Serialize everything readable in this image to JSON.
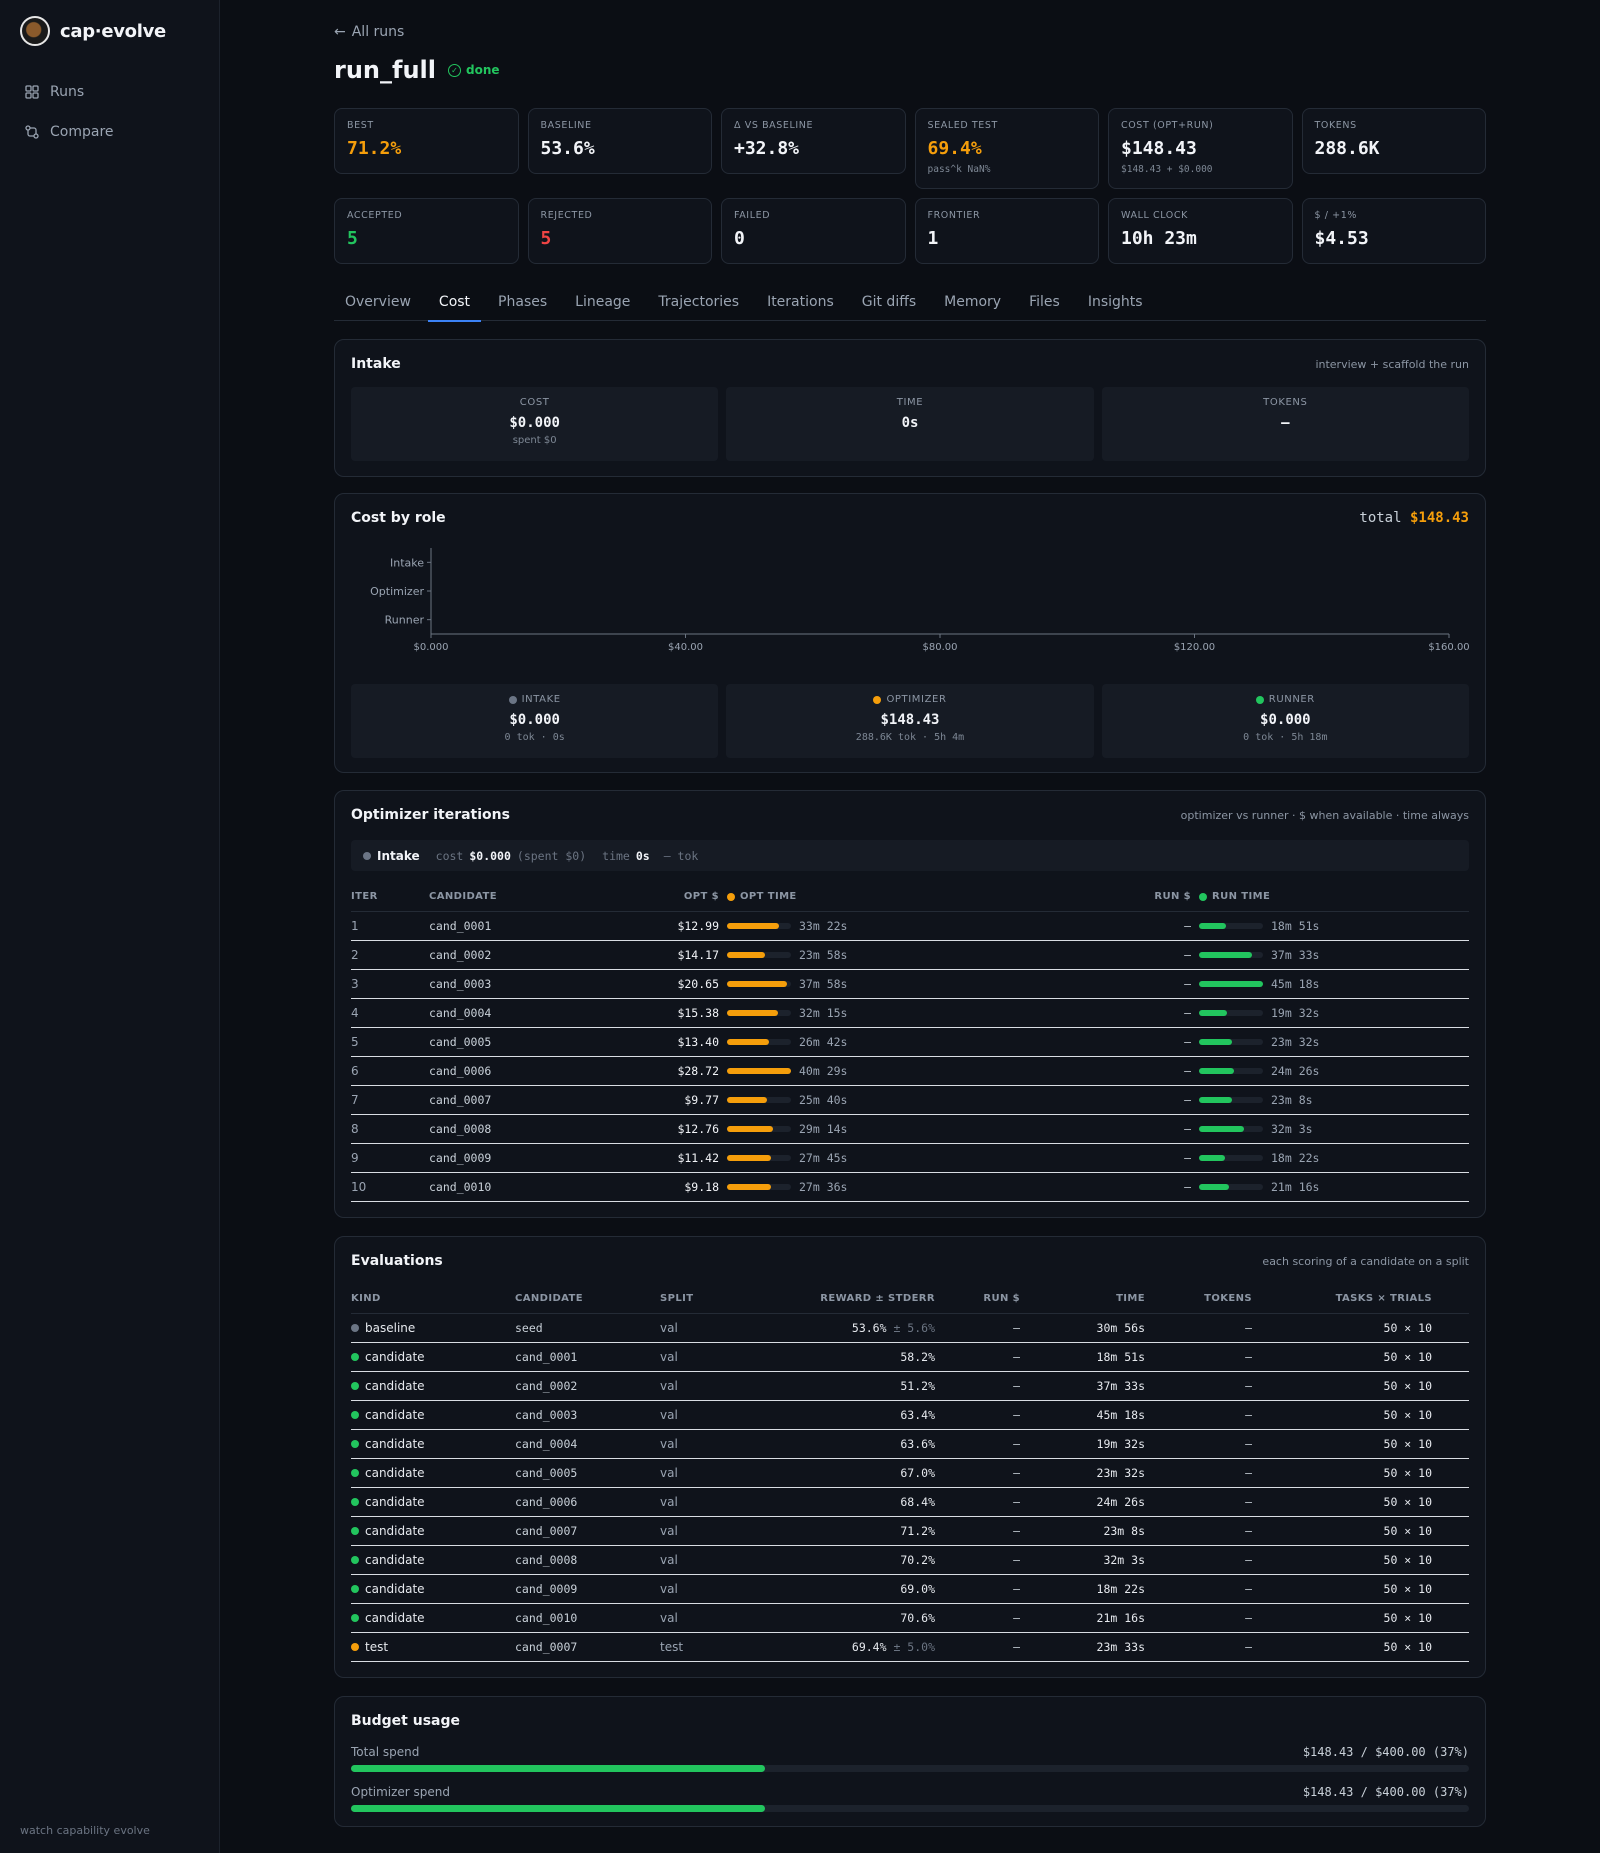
{
  "sidebar": {
    "brand": "cap·evolve",
    "nav": [
      {
        "label": "Runs",
        "icon": "grid-icon"
      },
      {
        "label": "Compare",
        "icon": "compare-icon"
      }
    ],
    "footer": "watch capability evolve"
  },
  "header": {
    "back_label": "All runs",
    "title": "run_full",
    "status": "done"
  },
  "stats_row1": [
    {
      "label": "BEST",
      "value": "71.2%",
      "tone": "orange",
      "sub": ""
    },
    {
      "label": "BASELINE",
      "value": "53.6%",
      "tone": "",
      "sub": ""
    },
    {
      "label": "Δ VS BASELINE",
      "value": "+32.8%",
      "tone": "",
      "sub": ""
    },
    {
      "label": "SEALED TEST",
      "value": "69.4%",
      "tone": "orange",
      "sub": "pass^k NaN%"
    },
    {
      "label": "COST (OPT+RUN)",
      "value": "$148.43",
      "tone": "",
      "sub": "$148.43 + $0.000"
    },
    {
      "label": "TOKENS",
      "value": "288.6K",
      "tone": "",
      "sub": ""
    }
  ],
  "stats_row2": [
    {
      "label": "ACCEPTED",
      "value": "5",
      "tone": "green"
    },
    {
      "label": "REJECTED",
      "value": "5",
      "tone": "red"
    },
    {
      "label": "FAILED",
      "value": "0",
      "tone": ""
    },
    {
      "label": "FRONTIER",
      "value": "1",
      "tone": ""
    },
    {
      "label": "WALL CLOCK",
      "value": "10h 23m",
      "tone": ""
    },
    {
      "label": "$ / +1%",
      "value": "$4.53",
      "tone": ""
    }
  ],
  "tabs": [
    "Overview",
    "Cost",
    "Phases",
    "Lineage",
    "Trajectories",
    "Iterations",
    "Git diffs",
    "Memory",
    "Files",
    "Insights"
  ],
  "active_tab": "Cost",
  "intake": {
    "title": "Intake",
    "note": "interview + scaffold the run",
    "metrics": [
      {
        "label": "COST",
        "value": "$0.000",
        "sub": "spent $0"
      },
      {
        "label": "TIME",
        "value": "0s",
        "sub": ""
      },
      {
        "label": "TOKENS",
        "value": "—",
        "sub": ""
      }
    ]
  },
  "cost_by_role": {
    "title": "Cost by role",
    "total_label": "total",
    "total_value": "$148.43",
    "roles": [
      {
        "label": "INTAKE",
        "value": "$0.000",
        "sub": "0 tok · 0s",
        "color": "#6b7585"
      },
      {
        "label": "OPTIMIZER",
        "value": "$148.43",
        "sub": "288.6K tok · 5h 4m",
        "color": "#f59e0b"
      },
      {
        "label": "RUNNER",
        "value": "$0.000",
        "sub": "0 tok · 5h 18m",
        "color": "#22c55e"
      }
    ]
  },
  "chart_data": {
    "type": "bar",
    "orientation": "horizontal",
    "categories": [
      "Intake",
      "Optimizer",
      "Runner"
    ],
    "values": [
      0,
      0,
      0
    ],
    "xlim": [
      0,
      160
    ],
    "xticks": [
      "$0.000",
      "$40.00",
      "$80.00",
      "$120.00",
      "$160.00"
    ],
    "xtick_values": [
      0,
      40,
      80,
      120,
      160
    ],
    "title": "",
    "xlabel": "",
    "ylabel": ""
  },
  "optimizer_iterations": {
    "title": "Optimizer iterations",
    "note": "optimizer vs runner · $ when available · time always",
    "strip": {
      "label": "Intake",
      "cost_key": "cost",
      "cost_val": "$0.000",
      "spent": "(spent $0)",
      "time_key": "time",
      "time_val": "0s",
      "tok": "— tok"
    },
    "headers": {
      "iter": "ITER",
      "candidate": "CANDIDATE",
      "opt_cost": "OPT $",
      "opt_time": "OPT TIME",
      "run_cost": "RUN $",
      "run_time": "RUN TIME"
    },
    "rows": [
      {
        "iter": "1",
        "candidate": "cand_0001",
        "opt_cost": "$12.99",
        "opt_time": "33m 22s",
        "opt_frac": 0.82,
        "run_cost": "—",
        "run_time": "18m 51s",
        "run_frac": 0.42
      },
      {
        "iter": "2",
        "candidate": "cand_0002",
        "opt_cost": "$14.17",
        "opt_time": "23m 58s",
        "opt_frac": 0.59,
        "run_cost": "—",
        "run_time": "37m 33s",
        "run_frac": 0.83
      },
      {
        "iter": "3",
        "candidate": "cand_0003",
        "opt_cost": "$20.65",
        "opt_time": "37m 58s",
        "opt_frac": 0.94,
        "run_cost": "—",
        "run_time": "45m 18s",
        "run_frac": 1.0
      },
      {
        "iter": "4",
        "candidate": "cand_0004",
        "opt_cost": "$15.38",
        "opt_time": "32m 15s",
        "opt_frac": 0.8,
        "run_cost": "—",
        "run_time": "19m 32s",
        "run_frac": 0.43
      },
      {
        "iter": "5",
        "candidate": "cand_0005",
        "opt_cost": "$13.40",
        "opt_time": "26m 42s",
        "opt_frac": 0.66,
        "run_cost": "—",
        "run_time": "23m 32s",
        "run_frac": 0.52
      },
      {
        "iter": "6",
        "candidate": "cand_0006",
        "opt_cost": "$28.72",
        "opt_time": "40m 29s",
        "opt_frac": 1.0,
        "run_cost": "—",
        "run_time": "24m 26s",
        "run_frac": 0.54
      },
      {
        "iter": "7",
        "candidate": "cand_0007",
        "opt_cost": "$9.77",
        "opt_time": "25m 40s",
        "opt_frac": 0.63,
        "run_cost": "—",
        "run_time": "23m 8s",
        "run_frac": 0.51
      },
      {
        "iter": "8",
        "candidate": "cand_0008",
        "opt_cost": "$12.76",
        "opt_time": "29m 14s",
        "opt_frac": 0.72,
        "run_cost": "—",
        "run_time": "32m 3s",
        "run_frac": 0.71
      },
      {
        "iter": "9",
        "candidate": "cand_0009",
        "opt_cost": "$11.42",
        "opt_time": "27m 45s",
        "opt_frac": 0.69,
        "run_cost": "—",
        "run_time": "18m 22s",
        "run_frac": 0.41
      },
      {
        "iter": "10",
        "candidate": "cand_0010",
        "opt_cost": "$9.18",
        "opt_time": "27m 36s",
        "opt_frac": 0.68,
        "run_cost": "—",
        "run_time": "21m 16s",
        "run_frac": 0.47
      }
    ]
  },
  "evaluations": {
    "title": "Evaluations",
    "note": "each scoring of a candidate on a split",
    "headers": {
      "kind": "KIND",
      "candidate": "CANDIDATE",
      "split": "SPLIT",
      "reward": "REWARD ± STDERR",
      "run_cost": "RUN $",
      "time": "TIME",
      "tokens": "TOKENS",
      "tasks": "TASKS × TRIALS"
    },
    "rows": [
      {
        "kind": "baseline",
        "dot": "#6b7585",
        "candidate": "seed",
        "split": "val",
        "reward": "53.6%",
        "stderr": "± 5.6%",
        "run_cost": "—",
        "time": "30m 56s",
        "tokens": "—",
        "tasks": "50 × 10"
      },
      {
        "kind": "candidate",
        "dot": "#22c55e",
        "candidate": "cand_0001",
        "split": "val",
        "reward": "58.2%",
        "stderr": "",
        "run_cost": "—",
        "time": "18m 51s",
        "tokens": "—",
        "tasks": "50 × 10"
      },
      {
        "kind": "candidate",
        "dot": "#22c55e",
        "candidate": "cand_0002",
        "split": "val",
        "reward": "51.2%",
        "stderr": "",
        "run_cost": "—",
        "time": "37m 33s",
        "tokens": "—",
        "tasks": "50 × 10"
      },
      {
        "kind": "candidate",
        "dot": "#22c55e",
        "candidate": "cand_0003",
        "split": "val",
        "reward": "63.4%",
        "stderr": "",
        "run_cost": "—",
        "time": "45m 18s",
        "tokens": "—",
        "tasks": "50 × 10"
      },
      {
        "kind": "candidate",
        "dot": "#22c55e",
        "candidate": "cand_0004",
        "split": "val",
        "reward": "63.6%",
        "stderr": "",
        "run_cost": "—",
        "time": "19m 32s",
        "tokens": "—",
        "tasks": "50 × 10"
      },
      {
        "kind": "candidate",
        "dot": "#22c55e",
        "candidate": "cand_0005",
        "split": "val",
        "reward": "67.0%",
        "stderr": "",
        "run_cost": "—",
        "time": "23m 32s",
        "tokens": "—",
        "tasks": "50 × 10"
      },
      {
        "kind": "candidate",
        "dot": "#22c55e",
        "candidate": "cand_0006",
        "split": "val",
        "reward": "68.4%",
        "stderr": "",
        "run_cost": "—",
        "time": "24m 26s",
        "tokens": "—",
        "tasks": "50 × 10"
      },
      {
        "kind": "candidate",
        "dot": "#22c55e",
        "candidate": "cand_0007",
        "split": "val",
        "reward": "71.2%",
        "stderr": "",
        "run_cost": "—",
        "time": "23m 8s",
        "tokens": "—",
        "tasks": "50 × 10"
      },
      {
        "kind": "candidate",
        "dot": "#22c55e",
        "candidate": "cand_0008",
        "split": "val",
        "reward": "70.2%",
        "stderr": "",
        "run_cost": "—",
        "time": "32m 3s",
        "tokens": "—",
        "tasks": "50 × 10"
      },
      {
        "kind": "candidate",
        "dot": "#22c55e",
        "candidate": "cand_0009",
        "split": "val",
        "reward": "69.0%",
        "stderr": "",
        "run_cost": "—",
        "time": "18m 22s",
        "tokens": "—",
        "tasks": "50 × 10"
      },
      {
        "kind": "candidate",
        "dot": "#22c55e",
        "candidate": "cand_0010",
        "split": "val",
        "reward": "70.6%",
        "stderr": "",
        "run_cost": "—",
        "time": "21m 16s",
        "tokens": "—",
        "tasks": "50 × 10"
      },
      {
        "kind": "test",
        "dot": "#f59e0b",
        "candidate": "cand_0007",
        "split": "test",
        "reward": "69.4%",
        "stderr": "± 5.0%",
        "run_cost": "—",
        "time": "23m 33s",
        "tokens": "—",
        "tasks": "50 × 10"
      }
    ]
  },
  "budget": {
    "title": "Budget usage",
    "rows": [
      {
        "label": "Total spend",
        "value": "$148.43 / $400.00 (37%)",
        "fraction": 0.37
      },
      {
        "label": "Optimizer spend",
        "value": "$148.43 / $400.00 (37%)",
        "fraction": 0.37
      }
    ]
  }
}
